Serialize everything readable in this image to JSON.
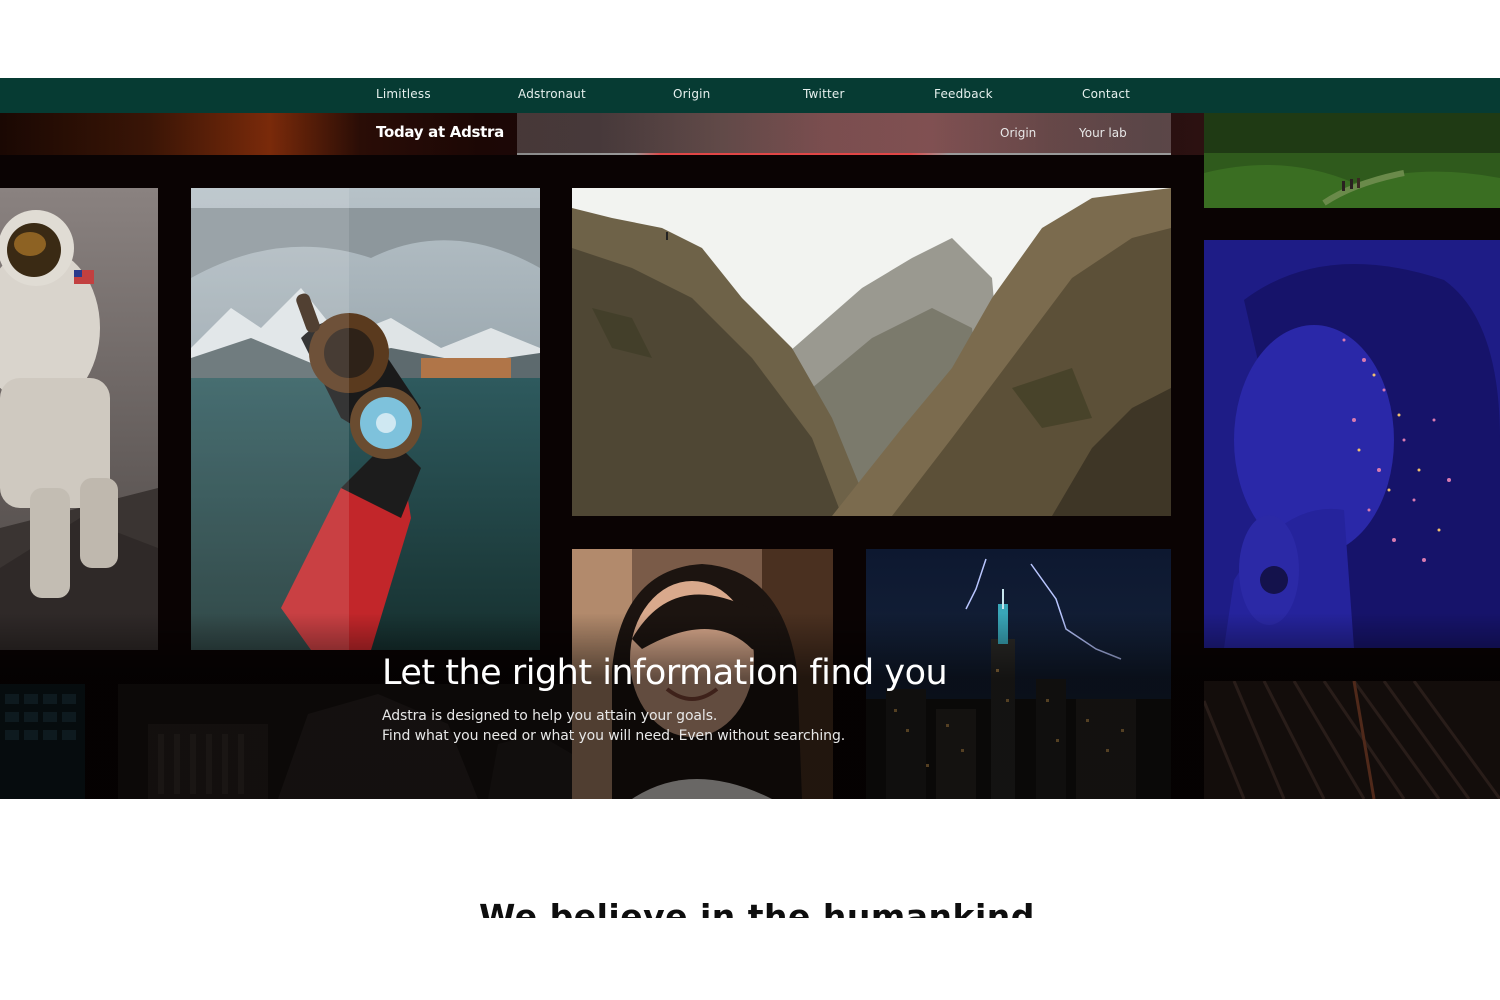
{
  "topnav": {
    "items": [
      "Limitless",
      "Adstronaut",
      "Origin",
      "Twitter",
      "Feedback",
      "Contact"
    ]
  },
  "subnav": {
    "brand": "Today at Adstra",
    "links": [
      "Origin",
      "Your lab"
    ]
  },
  "hero": {
    "headline": "Let the right information find you",
    "description_line1": "Adstra is designed to help you attain your goals.",
    "description_line2": "Find what you need or what you will need. Even without searching.",
    "photos": [
      "astronaut-photo",
      "compass-hand-photo",
      "mountain-canyon-photo",
      "woman-freckles-photo",
      "city-lightning-photo",
      "glitter-portrait-photo",
      "hikers-forest-photo",
      "building-ruins-photo",
      "architecture-lines-photo",
      "keyboard-photo"
    ]
  },
  "section": {
    "title": "We believe in the humankind"
  },
  "colors": {
    "nav_background": "#063b33",
    "hero_background": "#0a0303",
    "accent_red": "#e04646"
  }
}
